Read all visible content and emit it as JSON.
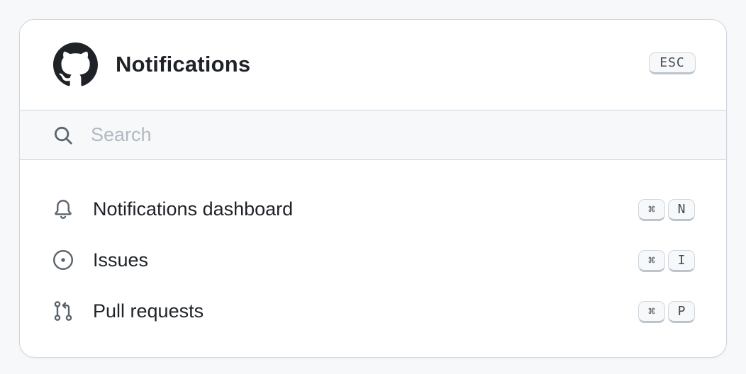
{
  "header": {
    "title": "Notifications",
    "close_key": "ESC",
    "logo_icon": "github-mark-icon"
  },
  "search": {
    "placeholder": "Search",
    "value": "",
    "icon": "search-icon"
  },
  "items": [
    {
      "label": "Notifications dashboard",
      "icon": "bell-icon",
      "modifier": "⌘",
      "key": "N"
    },
    {
      "label": "Issues",
      "icon": "issue-opened-icon",
      "modifier": "⌘",
      "key": "I"
    },
    {
      "label": "Pull requests",
      "icon": "git-pull-request-icon",
      "modifier": "⌘",
      "key": "P"
    }
  ],
  "colors": {
    "text": "#1f2328",
    "icon": "#59636e",
    "border": "#d0d7de",
    "search_bg": "#f6f8fa",
    "placeholder": "#b1b9c2"
  }
}
